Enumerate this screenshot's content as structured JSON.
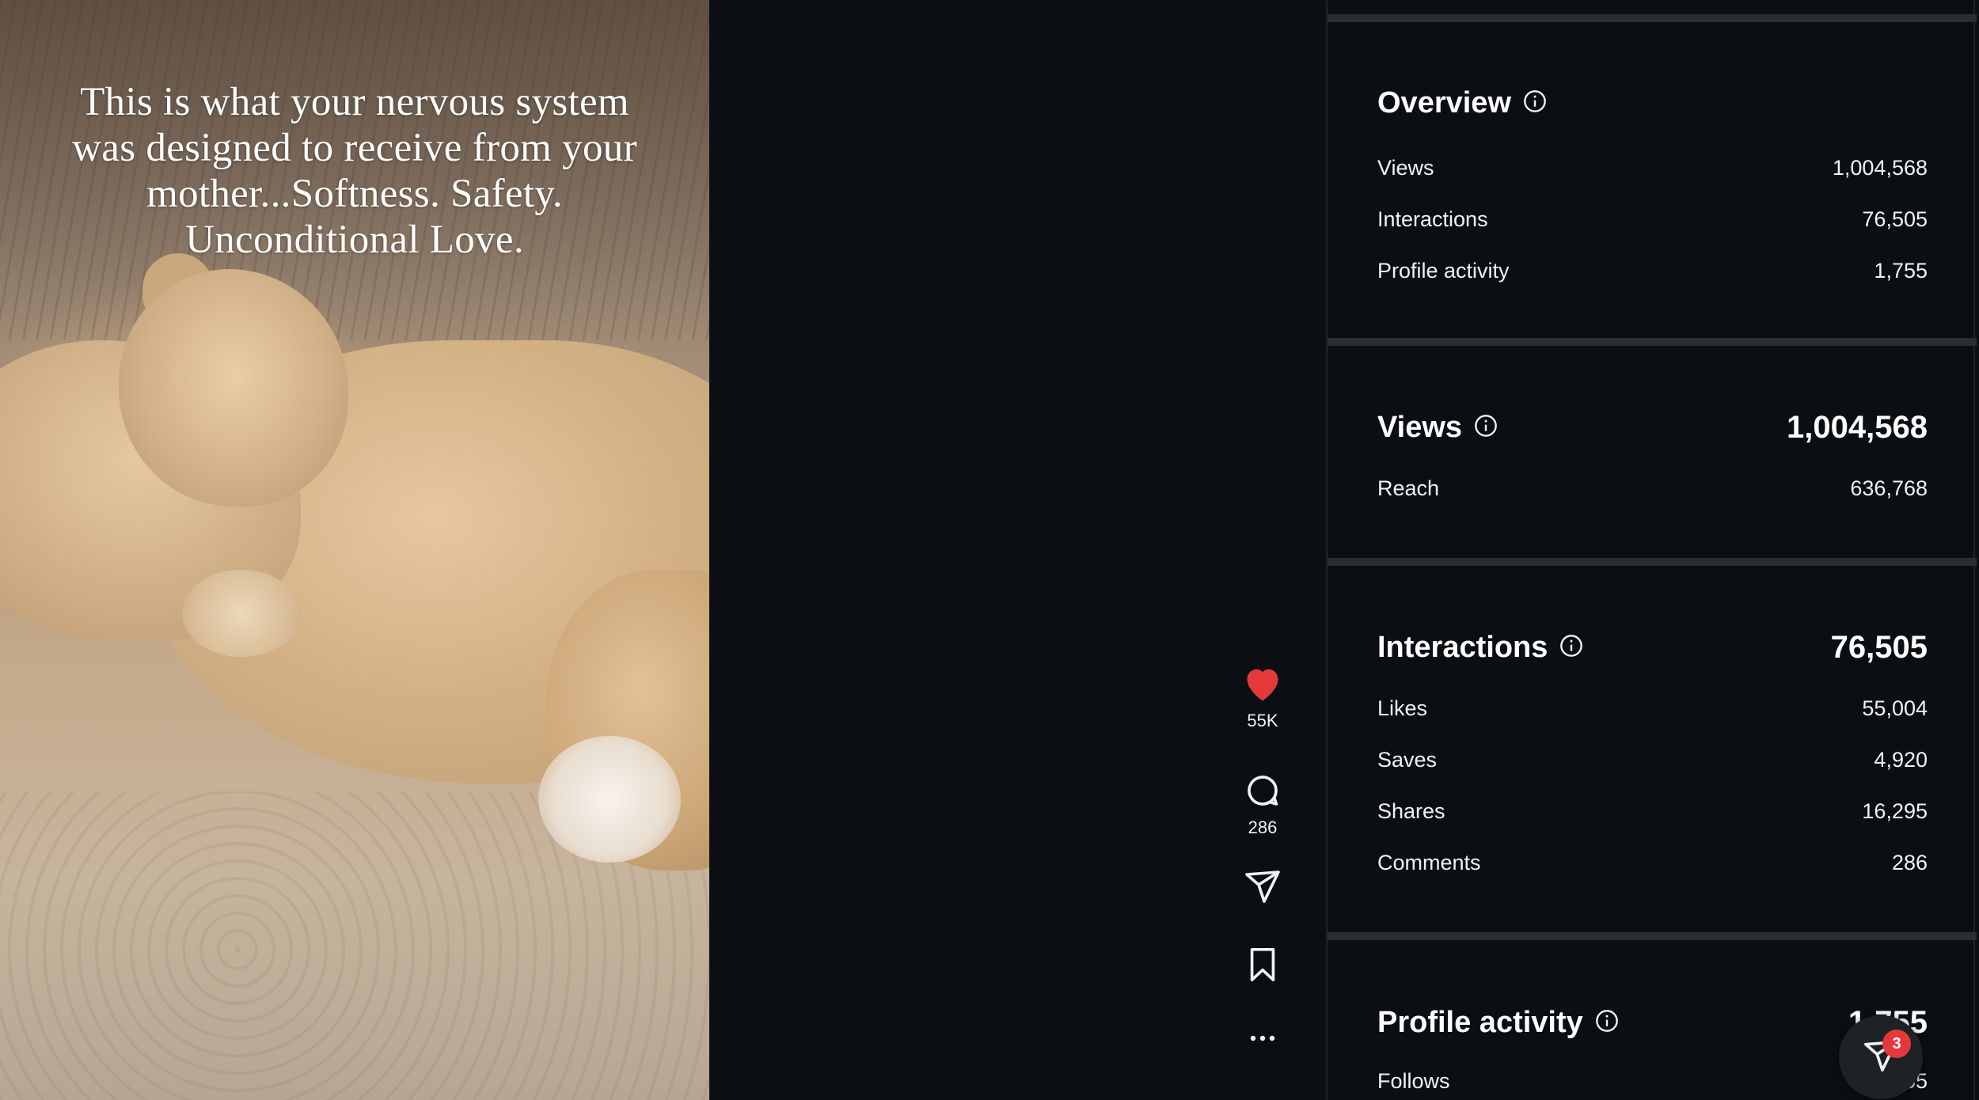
{
  "post": {
    "caption": "This is what your nervous system was designed to receive from your mother...Softness. Safety. Unconditional Love.",
    "media_subject": "lion cub playing with lioness"
  },
  "actions": {
    "likes_count": "55K",
    "comments_count": "286",
    "like_icon": "heart-filled-icon",
    "comment_icon": "comment-bubble-icon",
    "share_icon": "paper-plane-icon",
    "save_icon": "bookmark-icon",
    "more_icon": "more-dots-icon",
    "like_color": "#e5383b"
  },
  "insights": {
    "overview": {
      "title": "Overview",
      "rows": [
        {
          "label": "Views",
          "value": "1,004,568"
        },
        {
          "label": "Interactions",
          "value": "76,505"
        },
        {
          "label": "Profile activity",
          "value": "1,755"
        }
      ]
    },
    "views": {
      "title": "Views",
      "total": "1,004,568",
      "rows": [
        {
          "label": "Reach",
          "value": "636,768"
        }
      ]
    },
    "interactions": {
      "title": "Interactions",
      "total": "76,505",
      "rows": [
        {
          "label": "Likes",
          "value": "55,004"
        },
        {
          "label": "Saves",
          "value": "4,920"
        },
        {
          "label": "Shares",
          "value": "16,295"
        },
        {
          "label": "Comments",
          "value": "286"
        }
      ]
    },
    "profile_activity": {
      "title": "Profile activity",
      "total": "1,755",
      "rows": [
        {
          "label": "Follows",
          "value": "1,655"
        }
      ]
    }
  },
  "messages_fab": {
    "icon": "paper-plane-icon",
    "badge": "3",
    "badge_color": "#e5383b"
  }
}
